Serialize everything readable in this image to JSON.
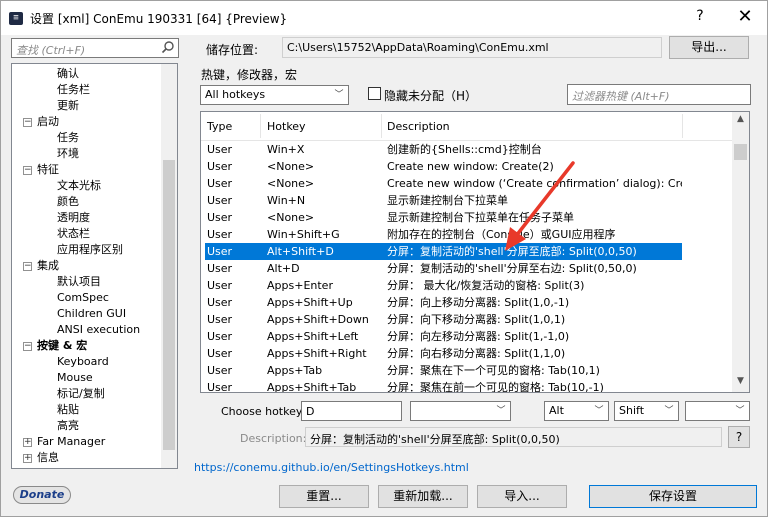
{
  "window": {
    "title": "设置 [xml] ConEmu 190331 [64] {Preview}",
    "app_icon": "conemu-icon",
    "help_glyph": "?",
    "close_glyph": "✕"
  },
  "sidebar": {
    "search_placeholder": "查找 (Ctrl+F)",
    "items": [
      {
        "label": "确认",
        "level": 2
      },
      {
        "label": "任务栏",
        "level": 2
      },
      {
        "label": "更新",
        "level": 2
      },
      {
        "label": "启动",
        "level": 1,
        "expander": "-"
      },
      {
        "label": "任务",
        "level": 2
      },
      {
        "label": "环境",
        "level": 2
      },
      {
        "label": "特征",
        "level": 1,
        "expander": "-"
      },
      {
        "label": "文本光标",
        "level": 2
      },
      {
        "label": "颜色",
        "level": 2
      },
      {
        "label": "透明度",
        "level": 2
      },
      {
        "label": "状态栏",
        "level": 2
      },
      {
        "label": "应用程序区别",
        "level": 2
      },
      {
        "label": "集成",
        "level": 1,
        "expander": "-"
      },
      {
        "label": "默认项目",
        "level": 2
      },
      {
        "label": "ComSpec",
        "level": 2
      },
      {
        "label": "Children GUI",
        "level": 2
      },
      {
        "label": "ANSI execution",
        "level": 2
      },
      {
        "label": "按键 & 宏",
        "level": 1,
        "expander": "-",
        "bold": true
      },
      {
        "label": "Keyboard",
        "level": 2
      },
      {
        "label": "Mouse",
        "level": 2
      },
      {
        "label": "标记/复制",
        "level": 2
      },
      {
        "label": "粘贴",
        "level": 2
      },
      {
        "label": "高亮",
        "level": 2
      },
      {
        "label": "Far Manager",
        "level": 1,
        "expander": "+"
      },
      {
        "label": "信息",
        "level": 1,
        "expander": "+"
      }
    ]
  },
  "storage": {
    "label": "储存位置:",
    "path": "C:\\Users\\15752\\AppData\\Roaming\\ConEmu.xml",
    "export_button": "导出..."
  },
  "hotkeys": {
    "group_label": "热键，修改器，宏",
    "filter_combo": "All hotkeys",
    "hide_unassigned_label": "隐藏未分配（H）",
    "hide_unassigned_checked": false,
    "filter_placeholder": "过滤器热键 (Alt+F)",
    "columns": [
      "Type",
      "Hotkey",
      "Description"
    ],
    "rows": [
      {
        "type": "User",
        "hotkey": "Win+X",
        "description": "创建新的{Shells::cmd}控制台"
      },
      {
        "type": "User",
        "hotkey": "<None>",
        "description": "Create new window: Create(2)"
      },
      {
        "type": "User",
        "hotkey": "<None>",
        "description": "Create new window (‘Create confirmation’ dialog): Create..."
      },
      {
        "type": "User",
        "hotkey": "Win+N",
        "description": "显示新建控制台下拉菜单"
      },
      {
        "type": "User",
        "hotkey": "<None>",
        "description": "显示新建控制台下拉菜单在任务子菜单"
      },
      {
        "type": "User",
        "hotkey": "Win+Shift+G",
        "description": "附加存在的控制台（Console）或GUI应用程序"
      },
      {
        "type": "User",
        "hotkey": "Alt+Shift+D",
        "description": "分屏：复制活动的'shell'分屏至底部: Split(0,0,50)",
        "selected": true
      },
      {
        "type": "User",
        "hotkey": "Alt+D",
        "description": "分屏：复制活动的'shell'分屏至右边: Split(0,50,0)"
      },
      {
        "type": "User",
        "hotkey": "Apps+Enter",
        "description": "分屏： 最大化/恢复活动的窗格: Split(3)"
      },
      {
        "type": "User",
        "hotkey": "Apps+Shift+Up",
        "description": "分屏：向上移动分离器: Split(1,0,-1)"
      },
      {
        "type": "User",
        "hotkey": "Apps+Shift+Down",
        "description": "分屏：向下移动分离器: Split(1,0,1)"
      },
      {
        "type": "User",
        "hotkey": "Apps+Shift+Left",
        "description": "分屏：向左移动分离器: Split(1,-1,0)"
      },
      {
        "type": "User",
        "hotkey": "Apps+Shift+Right",
        "description": "分屏：向右移动分离器: Split(1,1,0)"
      },
      {
        "type": "User",
        "hotkey": "Apps+Tab",
        "description": "分屏：聚焦在下一个可见的窗格: Tab(10,1)"
      },
      {
        "type": "User",
        "hotkey": "Apps+Shift+Tab",
        "description": "分屏：聚焦在前一个可见的窗格: Tab(10,-1)"
      }
    ]
  },
  "editor": {
    "choose_label": "Choose hotkey:",
    "hotkey_value": "D",
    "mod1": "Alt",
    "mod2": "Shift",
    "description_label": "Description:",
    "description_value": "分屏：复制活动的'shell'分屏至底部: Split(0,0,50)",
    "help_button": "?"
  },
  "footer": {
    "help_link": "https://conemu.github.io/en/SettingsHotkeys.html",
    "donate": "Donate",
    "reset": "重置...",
    "reload": "重新加载...",
    "import": "导入...",
    "save": "保存设置"
  },
  "colors": {
    "selection": "#0078d7",
    "annotation_arrow": "#e8392a",
    "link": "#0066cc"
  }
}
